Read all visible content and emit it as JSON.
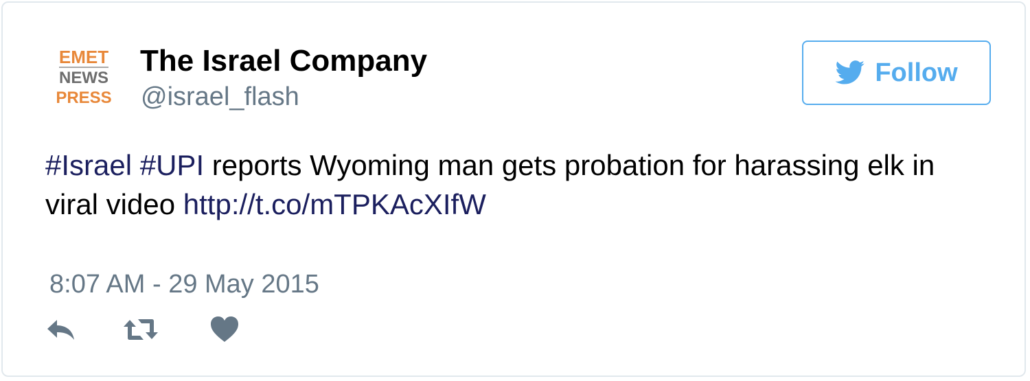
{
  "account": {
    "avatar": {
      "line1": "EMET",
      "line2": "NEWS",
      "line3": "PRESS"
    },
    "name": "The Israel Company",
    "handle": "@israel_flash"
  },
  "follow_button": {
    "label": "Follow",
    "icon": "twitter-bird-icon"
  },
  "tweet": {
    "hashtag1": "#Israel",
    "space1": " ",
    "hashtag2": "#UPI",
    "body": " reports Wyoming man gets probation for harassing elk in viral video ",
    "link": "http://t.co/mTPKAcXIfW"
  },
  "timestamp": "8:07 AM - 29 May 2015",
  "actions": [
    {
      "icon": "reply-icon"
    },
    {
      "icon": "retweet-icon"
    },
    {
      "icon": "heart-icon"
    }
  ],
  "colors": {
    "accent": "#55acee",
    "link": "#1b1f5e",
    "muted": "#657786",
    "icon": "#657786",
    "avatar_orange": "#e8883a",
    "avatar_gray": "#6d6d6d",
    "border": "#e1e8ed"
  }
}
